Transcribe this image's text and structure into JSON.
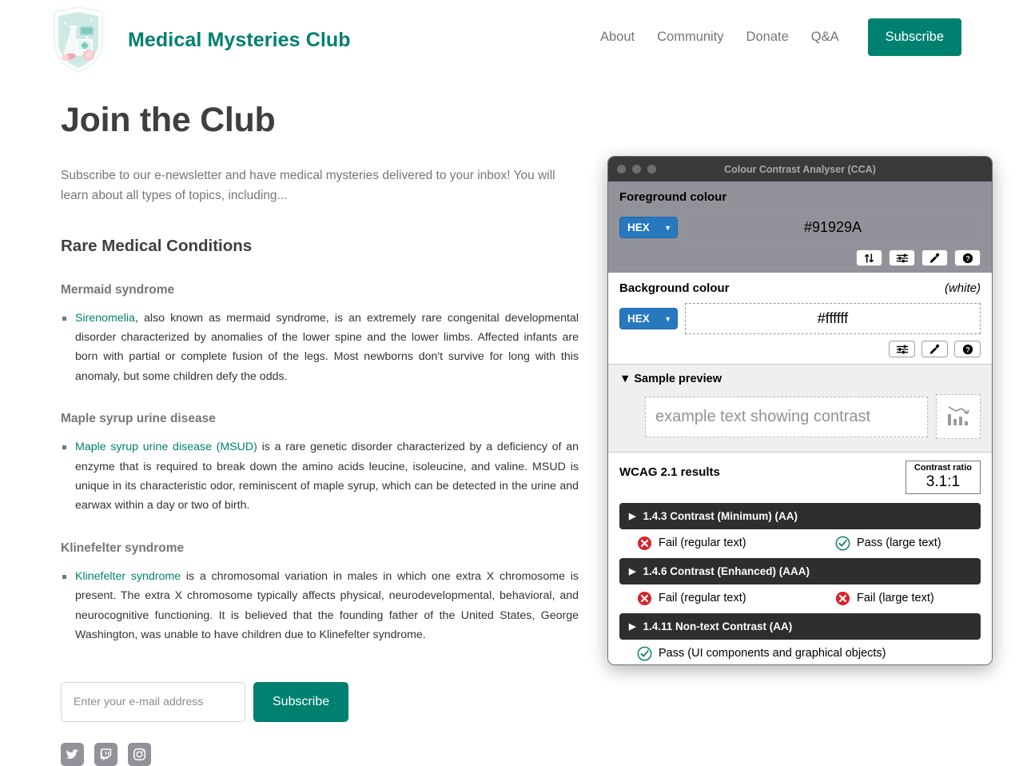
{
  "site": {
    "brand": {
      "title": "Medical Mysteries Club",
      "logo_icon": "shield-lab-logo",
      "accent_color": "#008070"
    },
    "nav": {
      "links": [
        {
          "label": "About",
          "name": "nav-link-about"
        },
        {
          "label": "Community",
          "name": "nav-link-community"
        },
        {
          "label": "Donate",
          "name": "nav-link-donate"
        },
        {
          "label": "Q&A",
          "name": "nav-link-qa"
        }
      ],
      "cta_label": "Subscribe"
    }
  },
  "main": {
    "page_title": "Join the Club",
    "intro": "Subscribe to our e-newsletter and have medical mysteries delivered to your inbox! You will learn about all types of topics, including...",
    "section_title": "Rare Medical Conditions",
    "conditions": [
      {
        "heading": "Mermaid syndrome",
        "link_text": "Sirenomelia",
        "body": ", also known as mermaid syndrome, is an extremely rare congenital developmental disorder characterized by anomalies of the lower spine and the lower limbs. Affected infants are born with partial or complete fusion of the legs. Most newborns don't survive for long with this anomaly, but some children defy the odds."
      },
      {
        "heading": "Maple syrup urine disease",
        "link_text": "Maple syrup urine disease (MSUD)",
        "body": " is a rare genetic disorder characterized by a deficiency of an enzyme that is required to break down the amino acids leucine, isoleucine, and valine. MSUD is unique in its characteristic odor, reminiscent of maple syrup, which can be detected in the urine and earwax within a day or two of birth."
      },
      {
        "heading": "Klinefelter syndrome",
        "link_text": "Klinefelter syndrome",
        "body": " is a chromosomal variation in males in which one extra X chromosome is present. The extra X chromosome typically affects physical, neurodevelopmental, behavioral, and neurocognitive functioning. It is believed that the founding father of the United States, George Washington, was unable to have children due to Klinefelter syndrome."
      }
    ],
    "form": {
      "email_placeholder": "Enter your e-mail address",
      "email_value": "",
      "submit_label": "Subscribe"
    },
    "social": [
      {
        "name": "twitter-icon",
        "label": "Twitter"
      },
      {
        "name": "twitch-icon",
        "label": "Twitch"
      },
      {
        "name": "instagram-icon",
        "label": "Instagram"
      }
    ]
  },
  "cca": {
    "window_title": "Colour Contrast Analyser (CCA)",
    "traffic_lights": [
      "close",
      "minimize",
      "maximize"
    ],
    "foreground": {
      "label": "Foreground colour",
      "format": "HEX",
      "value": "#91929A",
      "note": "",
      "icons": [
        {
          "name": "swap-colours-icon",
          "glyph": "swap"
        },
        {
          "name": "sliders-icon",
          "glyph": "sliders"
        },
        {
          "name": "eyedropper-icon",
          "glyph": "eyedropper"
        },
        {
          "name": "help-icon",
          "glyph": "help"
        }
      ]
    },
    "background": {
      "label": "Background colour",
      "format": "HEX",
      "value": "#ffffff",
      "note": "(white)",
      "icons": [
        {
          "name": "sliders-icon",
          "glyph": "sliders"
        },
        {
          "name": "eyedropper-icon",
          "glyph": "eyedropper"
        },
        {
          "name": "help-icon",
          "glyph": "help"
        }
      ]
    },
    "preview": {
      "disclosure_label": "Sample preview",
      "disclosure_glyph": "▼",
      "sample_text": "example text showing contrast",
      "graphic_icon": "declining-bar-chart-icon"
    },
    "results": {
      "title": "WCAG 2.1 results",
      "ratio_label": "Contrast ratio",
      "ratio_value": "3.1:1",
      "criteria": [
        {
          "label": "1.4.3 Contrast (Minimum) (AA)",
          "results": [
            {
              "status": "fail",
              "text": "Fail (regular text)"
            },
            {
              "status": "pass",
              "text": "Pass (large text)"
            }
          ]
        },
        {
          "label": "1.4.6 Contrast (Enhanced) (AAA)",
          "results": [
            {
              "status": "fail",
              "text": "Fail (regular text)"
            },
            {
              "status": "fail",
              "text": "Fail (large text)"
            }
          ]
        },
        {
          "label": "1.4.11 Non-text Contrast (AA)",
          "results": [
            {
              "status": "pass",
              "text": "Pass (UI components and graphical objects)"
            }
          ]
        }
      ]
    }
  }
}
